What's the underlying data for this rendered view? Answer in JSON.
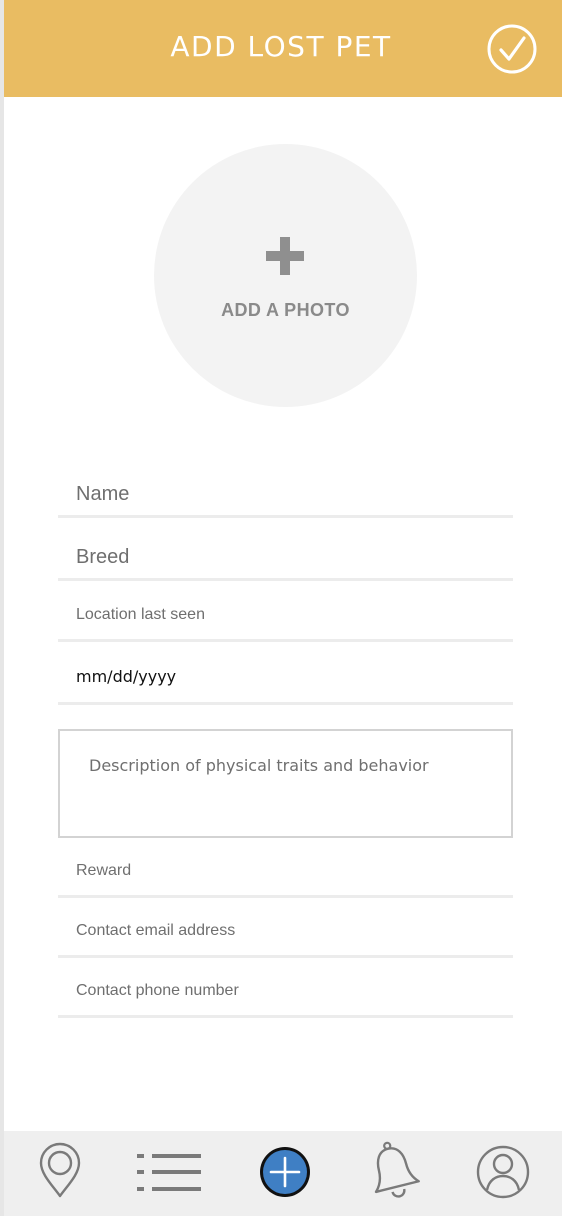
{
  "header": {
    "title": "ADD LOST PET",
    "confirm_icon": "check-circle-icon",
    "background": "#e9bc62"
  },
  "photo": {
    "label": "ADD A PHOTO",
    "icon": "plus-icon"
  },
  "form": {
    "name_placeholder": "Name",
    "breed_placeholder": "Breed",
    "location_placeholder": "Location last seen",
    "date_placeholder": "mm/dd/yyyy",
    "description_placeholder": "Description of physical traits and behavior",
    "reward_placeholder": "Reward",
    "email_placeholder": "Contact email address",
    "phone_placeholder": "Contact phone number"
  },
  "tabbar": {
    "items": [
      {
        "icon": "map-pin-icon"
      },
      {
        "icon": "list-icon"
      },
      {
        "icon": "add-circle-icon",
        "active": true,
        "accent": "#3f7fc4"
      },
      {
        "icon": "bell-icon"
      },
      {
        "icon": "user-icon"
      }
    ]
  }
}
